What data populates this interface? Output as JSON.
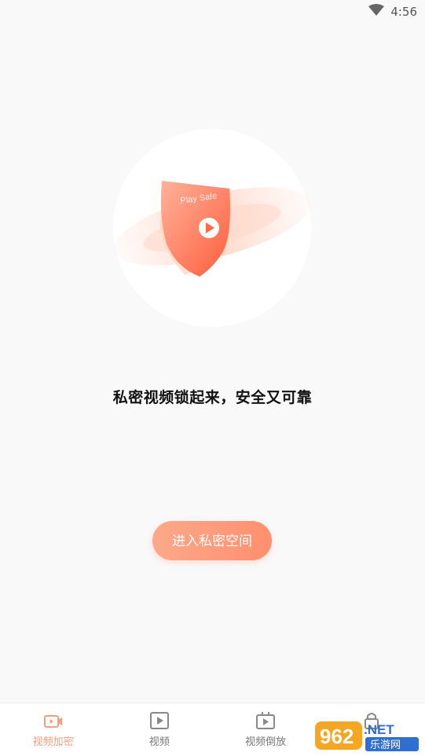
{
  "status_bar": {
    "time": "4:56"
  },
  "hero": {
    "shield_text": "Play Safe"
  },
  "main": {
    "tagline": "私密视频锁起来，安全又可靠",
    "enter_button": "进入私密空间"
  },
  "tabs": [
    {
      "label": "视频加密",
      "icon": "video-lock-icon",
      "active": true
    },
    {
      "label": "视频",
      "icon": "play-icon",
      "active": false
    },
    {
      "label": "视频倒放",
      "icon": "reverse-play-icon",
      "active": false
    },
    {
      "label": "",
      "icon": "lock-icon",
      "active": false
    }
  ],
  "watermark": {
    "text_top": "962.NET",
    "text_bottom": "乐游网"
  },
  "colors": {
    "accent": "#ff7a55",
    "active_tab": "#f4a080",
    "background": "#f9f9f9"
  }
}
